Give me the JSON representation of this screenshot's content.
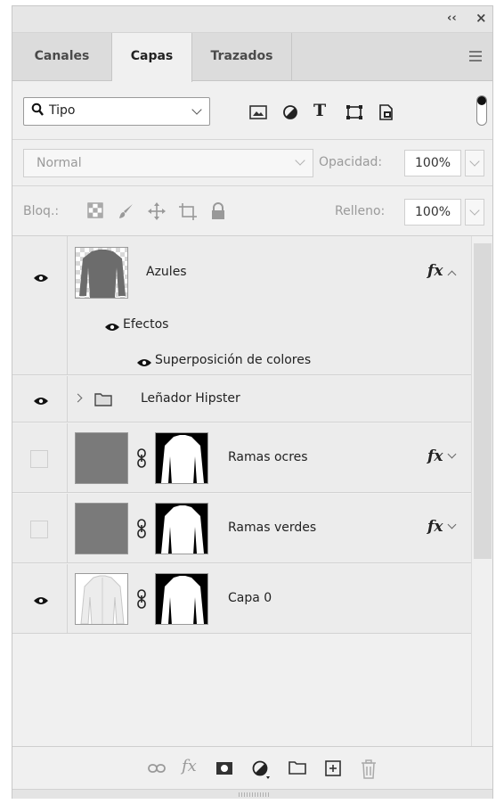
{
  "window": {
    "collapse_glyph": "‹‹",
    "close_glyph": "×"
  },
  "tabs": [
    {
      "label": "Canales",
      "active": false
    },
    {
      "label": "Capas",
      "active": true
    },
    {
      "label": "Trazados",
      "active": false
    }
  ],
  "filter": {
    "kind_label": "Tipo",
    "icons": [
      "image-filter-icon",
      "adjustment-filter-icon",
      "type-filter-icon",
      "shape-filter-icon",
      "smart-object-filter-icon"
    ],
    "type_glyph": "T"
  },
  "blend": {
    "mode": "Normal",
    "opacity_label": "Opacidad:",
    "opacity_value": "100%"
  },
  "lock": {
    "label": "Bloq.:",
    "fill_label": "Relleno:",
    "fill_value": "100%"
  },
  "layers": [
    {
      "name": "Azules",
      "visible": true,
      "has_fx": true,
      "fx_label": "fx",
      "effects_label": "Efectos",
      "effect_name": "Superposición de colores"
    },
    {
      "name": "Leñador Hipster",
      "visible": true,
      "type": "group"
    },
    {
      "name": "Ramas ocres",
      "visible": false,
      "has_fx": true,
      "fx_label": "fx"
    },
    {
      "name": "Ramas verdes",
      "visible": false,
      "has_fx": true,
      "fx_label": "fx"
    },
    {
      "name": "Capa 0",
      "visible": true,
      "has_fx": false
    }
  ],
  "bottom": {
    "fx_label": "fx",
    "icons": [
      "link-layers-icon",
      "add-style-icon",
      "add-mask-icon",
      "new-adjustment-icon",
      "new-group-icon",
      "new-layer-icon",
      "delete-icon"
    ]
  },
  "colors": {
    "panel_bg": "#f0f0f0",
    "tab_bg": "#dcdcdc",
    "thumb_gray": "#7a7a7a"
  }
}
